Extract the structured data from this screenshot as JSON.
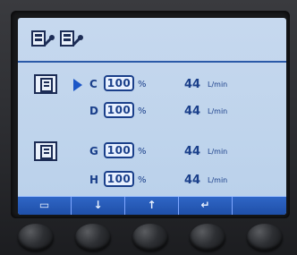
{
  "screen": {
    "top_icons": [
      "pump-wrench-icon",
      "pump-wrench-icon"
    ],
    "pumps": [
      {
        "rows": [
          {
            "channel": "C",
            "percent": "100",
            "percent_unit": "%",
            "flow": "44",
            "unit": "L/min",
            "selected": true
          },
          {
            "channel": "D",
            "percent": "100",
            "percent_unit": "%",
            "flow": "44",
            "unit": "L/min",
            "selected": false
          }
        ]
      },
      {
        "rows": [
          {
            "channel": "G",
            "percent": "100",
            "percent_unit": "%",
            "flow": "44",
            "unit": "L/min",
            "selected": false
          },
          {
            "channel": "H",
            "percent": "100",
            "percent_unit": "%",
            "flow": "44",
            "unit": "L/min",
            "selected": false
          }
        ]
      }
    ],
    "softkeys": [
      {
        "icon": "keyboard-icon",
        "label": "▭"
      },
      {
        "icon": "down-arrow-icon",
        "label": "↓"
      },
      {
        "icon": "up-arrow-icon",
        "label": "↑"
      },
      {
        "icon": "enter-icon",
        "label": "↵"
      },
      {
        "icon": "blank-icon",
        "label": ""
      }
    ]
  },
  "colors": {
    "accent": "#1b56c7",
    "text": "#1a3f8a",
    "screen_bg": "#c6d8ee",
    "softkey_bar": "#2f66c6"
  }
}
